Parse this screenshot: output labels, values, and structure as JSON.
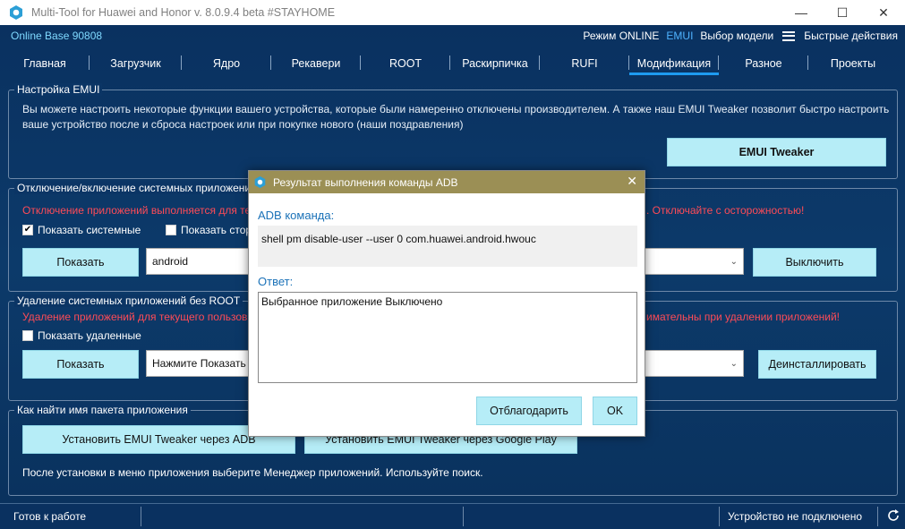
{
  "window": {
    "title": "Multi-Tool for Huawei and Honor v. 8.0.9.4 beta #STAYHOME",
    "minimize": "—",
    "maximize": "☐",
    "close": "✕"
  },
  "topbar": {
    "online_base": "Online Base 90808",
    "mode": "Режим ONLINE",
    "emui": "EMUI",
    "model_select": "Выбор модели",
    "quick_actions": "Быстрые действия"
  },
  "tabs": [
    {
      "label": "Главная"
    },
    {
      "label": "Загрузчик"
    },
    {
      "label": "Ядро"
    },
    {
      "label": "Рекавери"
    },
    {
      "label": "ROOT"
    },
    {
      "label": "Раскирпичка"
    },
    {
      "label": "RUFI"
    },
    {
      "label": "Модификация"
    },
    {
      "label": "Разное"
    },
    {
      "label": "Проекты"
    }
  ],
  "emui_settings": {
    "title": "Настройка EMUI",
    "description": "Вы можете настроить некоторые функции вашего устройства, которые были намеренно отключены производителем. А также наш EMUI Tweaker позволит быстро настроить ваше устройство после и сброса настроек или при покупке нового (наши поздравления)",
    "tweaker_button": "EMUI Tweaker"
  },
  "disable_apps": {
    "title": "Отключение/включение системных приложений",
    "warning_left": "Отключение приложений выполняется для те",
    "warning_right": ". Отключайте с осторожностью!",
    "show_system": "Показать системные",
    "show_third": "Показать стор",
    "show_button": "Показать",
    "combo_value": "android",
    "disable_button": "Выключить"
  },
  "remove_apps": {
    "title": "Удаление системных приложений без ROOT",
    "warning_left": "Удаление приложений для текущего пользов",
    "warning_right": "имательны при удалении приложений!",
    "show_removed": "Показать удаленные",
    "show_button": "Показать",
    "combo_value": "Нажмите Показать",
    "uninstall_button": "Деинсталлировать"
  },
  "find_package": {
    "title": "Как найти имя пакета приложения",
    "adb_button": "Установить EMUI Tweaker через ADB",
    "play_button": "Установить EMUI Tweaker через Google Play",
    "note": "После установки в меню приложения выберите Менеджер приложений. Используйте поиск."
  },
  "status": {
    "left": "Готов к работе",
    "right": "Устройство не подключено"
  },
  "dialog": {
    "title": "Результат выполнения команды ADB",
    "close": "✕",
    "cmd_label": "ADB команда:",
    "cmd_value": "shell pm disable-user --user 0 com.huawei.android.hwouc",
    "answer_label": "Ответ:",
    "answer_value": "Выбранное приложение Выключено",
    "thank_button": "Отблагодарить",
    "ok_button": "OK"
  },
  "colors": {
    "background": "#0b3565",
    "accent": "#1e9bf0",
    "button": "#b6edf7",
    "warning": "#ff4b57",
    "dialog_title": "#9b8f55"
  }
}
